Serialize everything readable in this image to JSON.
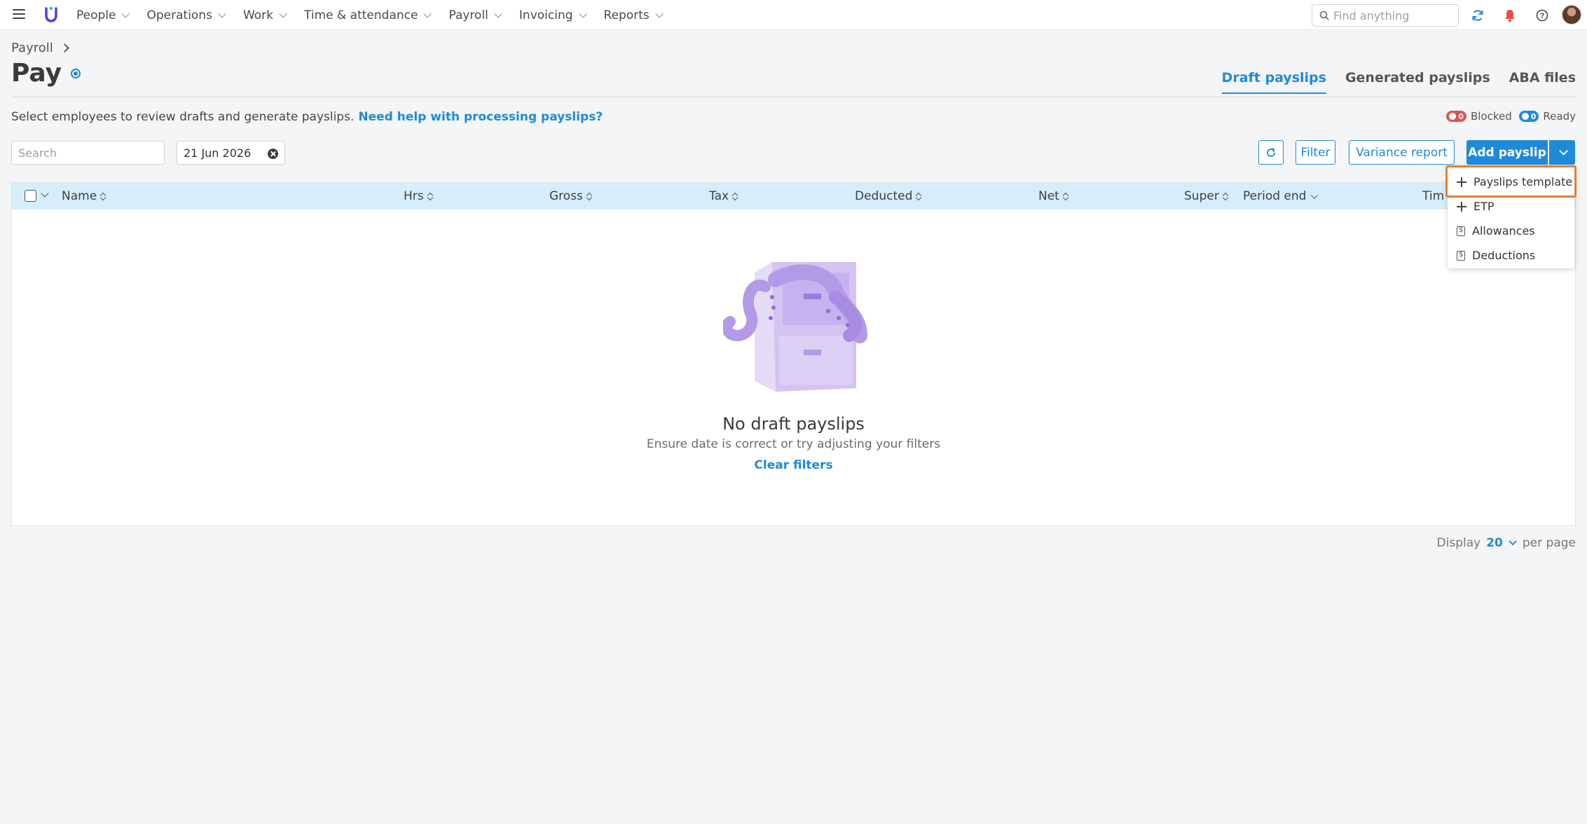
{
  "topnav": {
    "nav_items": [
      "People",
      "Operations",
      "Work",
      "Time & attendance",
      "Payroll",
      "Invoicing",
      "Reports"
    ],
    "search_placeholder": "Find anything",
    "colors": {
      "brand": "#5a3fd9",
      "notification": "#e4514c",
      "refresh": "#1f8ad8"
    }
  },
  "header": {
    "breadcrumb": "Payroll",
    "title": "Pay",
    "tabs": [
      {
        "label": "Draft payslips",
        "active": true
      },
      {
        "label": "Generated payslips",
        "active": false
      },
      {
        "label": "ABA files",
        "active": false
      }
    ]
  },
  "intro": {
    "text": "Select employees to review drafts and generate payslips.",
    "help_link": "Need help with processing payslips?"
  },
  "status": {
    "blocked_count": "0",
    "blocked_label": "Blocked",
    "ready_count": "0",
    "ready_label": "Ready"
  },
  "toolbar": {
    "search_placeholder": "Search",
    "date": "21 Jun 2026",
    "filter_label": "Filter",
    "variance_label": "Variance report",
    "add_payslip_label": "Add payslip"
  },
  "table": {
    "columns": [
      "Name",
      "Hrs",
      "Gross",
      "Tax",
      "Deducted",
      "Net",
      "Super",
      "Period end",
      "Tim"
    ]
  },
  "empty_state": {
    "title": "No draft payslips",
    "subtitle": "Ensure date is correct or try adjusting your filters",
    "action": "Clear filters"
  },
  "pagination": {
    "display_label": "Display",
    "per_page_value": "20",
    "per_page_label": "per page"
  },
  "add_menu": {
    "items": [
      {
        "label": "Payslips template",
        "icon": "plus-icon"
      },
      {
        "label": "ETP",
        "icon": "plus-icon"
      },
      {
        "label": "Allowances",
        "icon": "document-dollar-icon"
      },
      {
        "label": "Deductions",
        "icon": "document-dollar-icon"
      }
    ]
  },
  "colors": {
    "accent": "#1f8ad8",
    "table_header": "#d6eefb",
    "highlight": "#e0803a",
    "illustration": "#b39ae6"
  }
}
